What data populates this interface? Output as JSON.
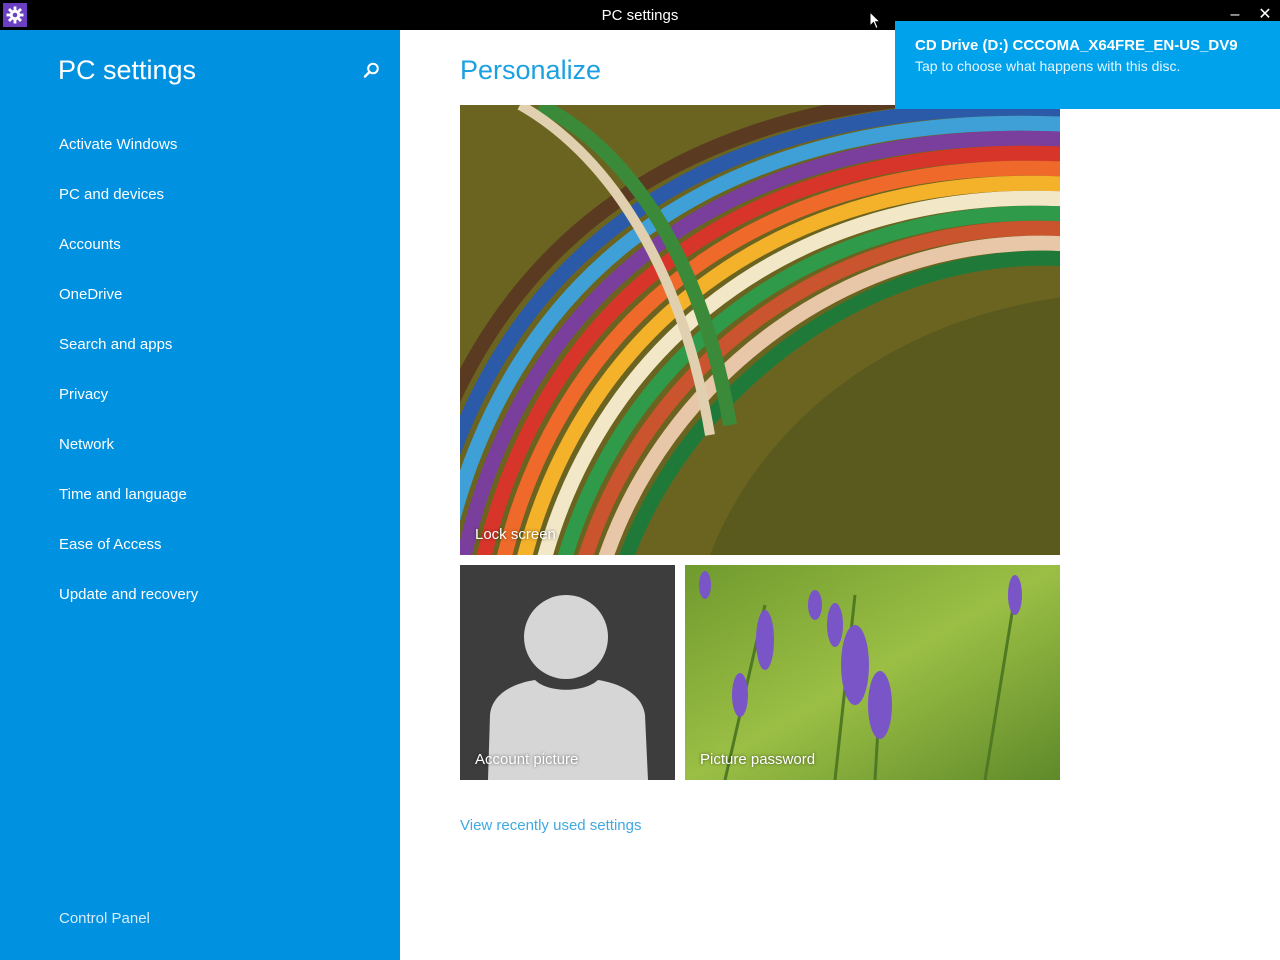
{
  "window": {
    "title": "PC settings",
    "minimize_glyph": "–",
    "close_glyph": "✕",
    "app_icon": "gear-icon"
  },
  "sidebar": {
    "title": "PC settings",
    "search_icon": "search-icon",
    "items": [
      {
        "label": "Activate Windows"
      },
      {
        "label": "PC and devices"
      },
      {
        "label": "Accounts"
      },
      {
        "label": "OneDrive"
      },
      {
        "label": "Search and apps"
      },
      {
        "label": "Privacy"
      },
      {
        "label": "Network"
      },
      {
        "label": "Time and language"
      },
      {
        "label": "Ease of Access"
      },
      {
        "label": "Update and recovery"
      }
    ],
    "control_panel": "Control Panel"
  },
  "main": {
    "title": "Personalize",
    "tiles": {
      "lock_screen": "Lock screen",
      "account_picture": "Account picture",
      "picture_password": "Picture password"
    },
    "recent_link": "View recently used settings"
  },
  "toast": {
    "title": "CD Drive (D:) CCCOMA_X64FRE_EN-US_DV9",
    "body": "Tap to choose what happens with this disc."
  },
  "colors": {
    "sidebar_bg": "#0091e0",
    "accent": "#1ba1e2",
    "toast_bg": "#00a2ec",
    "titlebar_bg": "#000000"
  }
}
